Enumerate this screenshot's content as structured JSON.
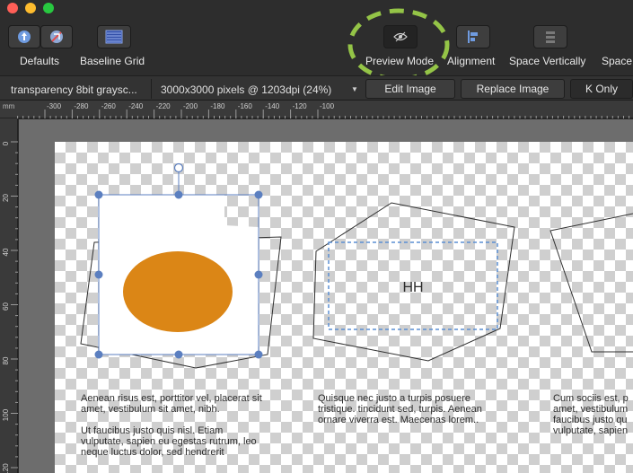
{
  "toolbar": {
    "defaults_label": "Defaults",
    "baseline_grid_label": "Baseline Grid",
    "preview_mode_label": "Preview Mode",
    "alignment_label": "Alignment",
    "space_vertically_label": "Space Vertically",
    "space_label": "Space"
  },
  "context_bar": {
    "image_info": "transparency 8bit graysc...",
    "resolution": "3000x3000 pixels @ 1203dpi (24%)",
    "edit_image_label": "Edit Image",
    "replace_image_label": "Replace Image",
    "k_only_label": "K Only"
  },
  "rulers": {
    "unit": "mm",
    "horizontal_ticks": [
      "-300",
      "-280",
      "-260",
      "-240",
      "-220",
      "-200",
      "-180",
      "-160",
      "-140",
      "-120",
      "-100"
    ],
    "vertical_ticks": [
      "0",
      "20",
      "40",
      "60",
      "80",
      "100",
      "120"
    ]
  },
  "canvas": {
    "text_frame_label": "HH",
    "text_blocks": [
      {
        "paragraphs": [
          [
            "Aenean risus est, porttitor vel, placerat sit",
            "amet, vestibulum sit amet, nibh."
          ],
          [
            "Ut faucibus justo quis nisl. Etiam",
            "vulputate, sapien eu egestas rutrum, leo",
            "neque luctus dolor, sed hendrerit"
          ]
        ]
      },
      {
        "paragraphs": [
          [
            "Quisque nec justo a turpis posuere",
            "tristique. tincidunt sed, turpis. Aenean",
            "ornare viverra est. Maecenas lorem.."
          ]
        ]
      },
      {
        "paragraphs": [
          [
            "Cum sociis est, p",
            "amet, vestibulum",
            "faucibus justo qu",
            "vulputate, sapien"
          ]
        ]
      }
    ]
  },
  "colors": {
    "selection": "#5b7fc0",
    "ellipse_fill": "#db8616",
    "annotation": "#94c447"
  }
}
